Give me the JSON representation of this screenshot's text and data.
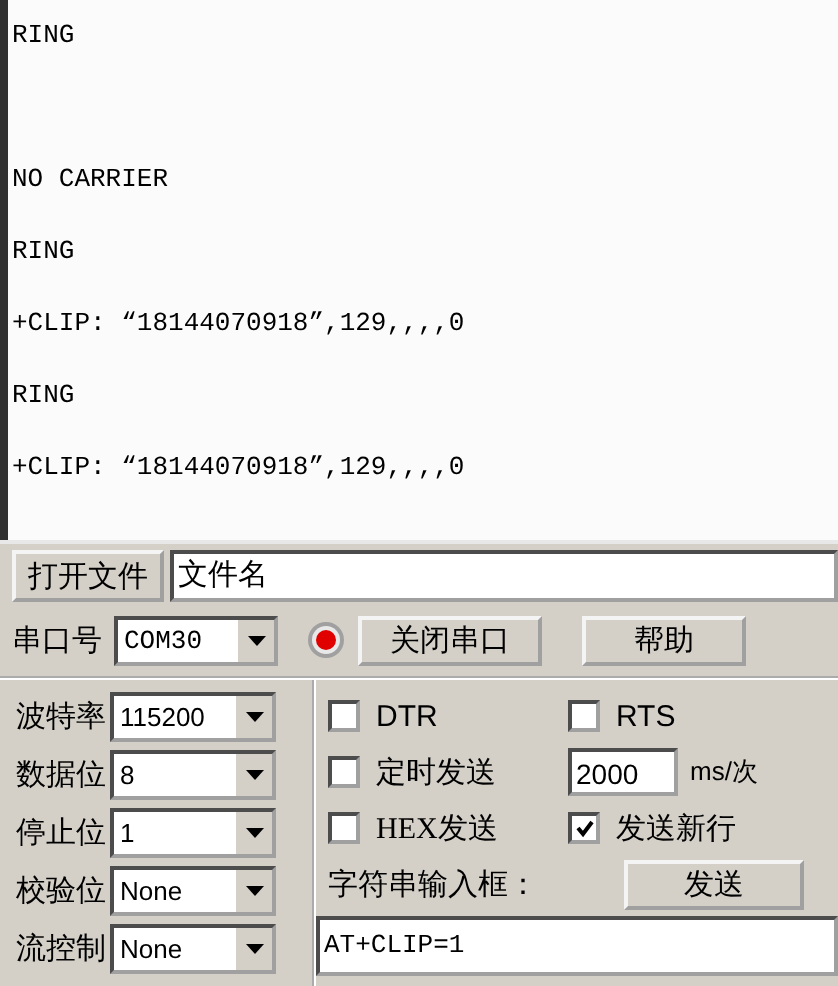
{
  "log": {
    "blocks": [
      [
        "RING"
      ],
      [
        "NO CARRIER",
        "RING",
        "+CLIP: “18144070918”,129,,,,0",
        "RING",
        "+CLIP: “18144070918”,129,,,,0"
      ]
    ]
  },
  "file_row": {
    "button": "打开文件",
    "field": "文件名"
  },
  "port_row": {
    "label": "串口号",
    "port": "COM30",
    "indicator_on": true,
    "close_button": "关闭串口",
    "help_button": "帮助"
  },
  "settings": [
    {
      "label": "波特率",
      "value": "115200"
    },
    {
      "label": "数据位",
      "value": "8"
    },
    {
      "label": "停止位",
      "value": "1"
    },
    {
      "label": "校验位",
      "value": "None"
    },
    {
      "label": "流控制",
      "value": "None"
    }
  ],
  "options": {
    "dtr": {
      "label": "DTR",
      "checked": false
    },
    "rts": {
      "label": "RTS",
      "checked": false
    },
    "timed_send": {
      "label": "定时发送",
      "checked": false
    },
    "interval": "2000",
    "interval_unit": "ms/次",
    "hex_send": {
      "label": "HEX发送",
      "checked": false
    },
    "send_newline": {
      "label": "发送新行",
      "checked": true
    },
    "input_label": "字符串输入框：",
    "send_button": "发送",
    "input": "AT+CLIP=1"
  }
}
